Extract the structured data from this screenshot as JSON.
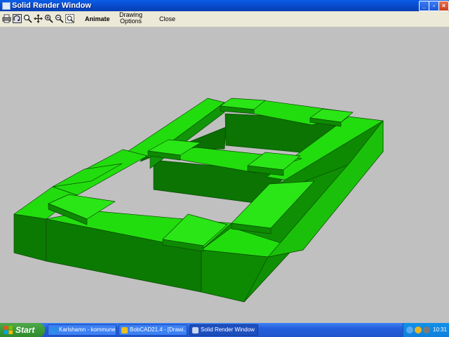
{
  "window": {
    "title": "Solid Render Window",
    "controls": [
      "minimize",
      "maximize",
      "close"
    ]
  },
  "toolbar": {
    "icons": [
      "print-icon",
      "redraw-icon",
      "zoom-window-icon",
      "pan-icon",
      "zoom-in-icon",
      "zoom-out-icon",
      "zoom-fit-icon"
    ],
    "animate_label": "Animate",
    "drawing_options_line1": "Drawing",
    "drawing_options_line2": "Options",
    "close_label": "Close"
  },
  "viewport": {
    "background": "#c0c0c0",
    "model_color_top": "#22dd0e",
    "model_color_side": "#0d8a02",
    "model_color_dark": "#0a6e02"
  },
  "taskbar": {
    "start_label": "Start",
    "tasks": [
      {
        "label": "Karlshamn - kommune...",
        "icon": "ie-icon",
        "active": false
      },
      {
        "label": "BobCAD21.4 - [Drawi...",
        "icon": "bobcad-icon",
        "active": false
      },
      {
        "label": "Solid Render Window",
        "icon": "window-icon",
        "active": true
      }
    ],
    "clock": "10:31"
  }
}
